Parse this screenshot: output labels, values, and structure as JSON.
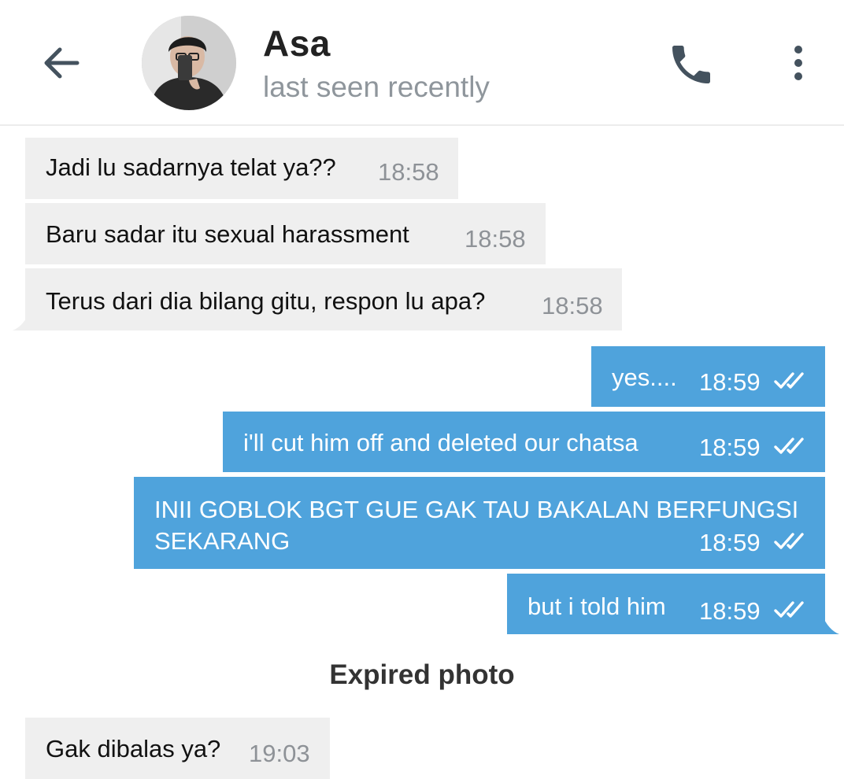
{
  "header": {
    "back_icon": "arrow-left-icon",
    "name": "Asa",
    "status": "last seen recently",
    "call_icon": "phone-icon",
    "menu_icon": "more-vertical-icon"
  },
  "messages": [
    {
      "direction": "in",
      "text": "Jadi lu sadarnya telat ya??",
      "time": "18:58"
    },
    {
      "direction": "in",
      "text": "Baru sadar itu sexual harassment",
      "time": "18:58"
    },
    {
      "direction": "in",
      "text": "Terus dari dia bilang gitu, respon lu apa?",
      "time": "18:58"
    },
    {
      "direction": "out",
      "text": "yes....",
      "time": "18:59",
      "status": "read"
    },
    {
      "direction": "out",
      "text": "i'll cut him off and deleted our chatsa",
      "time": "18:59",
      "status": "read"
    },
    {
      "direction": "out",
      "line1": "INII GOBLOK BGT GUE GAK TAU BAKALAN BERFUNGSI",
      "line2": "SEKARANG",
      "time": "18:59",
      "status": "read"
    },
    {
      "direction": "out",
      "text": "but i told him",
      "time": "18:59",
      "status": "read"
    },
    {
      "direction": "in",
      "text": "Gak dibalas ya?",
      "time": "19:03"
    }
  ],
  "service_message": "Expired photo",
  "colors": {
    "incoming_bubble": "#efefef",
    "outgoing_bubble": "#4fa3dc",
    "icon": "#44525e",
    "time_incoming": "#8e9297"
  }
}
